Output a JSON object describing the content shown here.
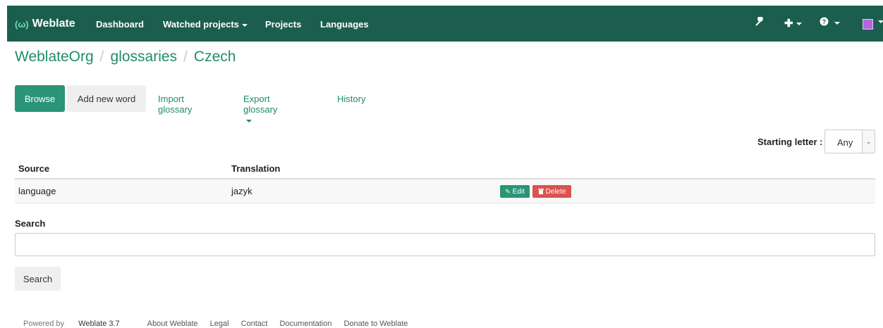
{
  "navbar": {
    "brand": "Weblate",
    "links": {
      "dashboard": "Dashboard",
      "watched": "Watched projects",
      "projects": "Projects",
      "languages": "Languages"
    },
    "icons": [
      "wrench-icon",
      "plus-icon",
      "help-icon",
      "avatar"
    ]
  },
  "breadcrumb": {
    "project": "WeblateOrg",
    "glossary": "glossaries",
    "language": "Czech"
  },
  "tabs": {
    "browse": "Browse",
    "add": "Add new word",
    "import": "Import glossary",
    "export": "Export glossary",
    "history": "History"
  },
  "filter": {
    "label": "Starting letter :",
    "value": "Any"
  },
  "table": {
    "headers": {
      "source": "Source",
      "translation": "Translation"
    },
    "rows": [
      {
        "source": "language",
        "translation": "jazyk",
        "edit": "Edit",
        "delete": "Delete"
      }
    ]
  },
  "search": {
    "label": "Search",
    "placeholder": "",
    "button": "Search"
  },
  "footer": {
    "powered": "Powered by",
    "version": "Weblate 3.7",
    "about": "About Weblate",
    "legal": "Legal",
    "contact": "Contact",
    "docs": "Documentation",
    "donate": "Donate to Weblate"
  },
  "colors": {
    "navbar": "#1b5e4d",
    "accent": "#2a9577",
    "link": "#1f8c6c",
    "danger": "#d9534f"
  }
}
